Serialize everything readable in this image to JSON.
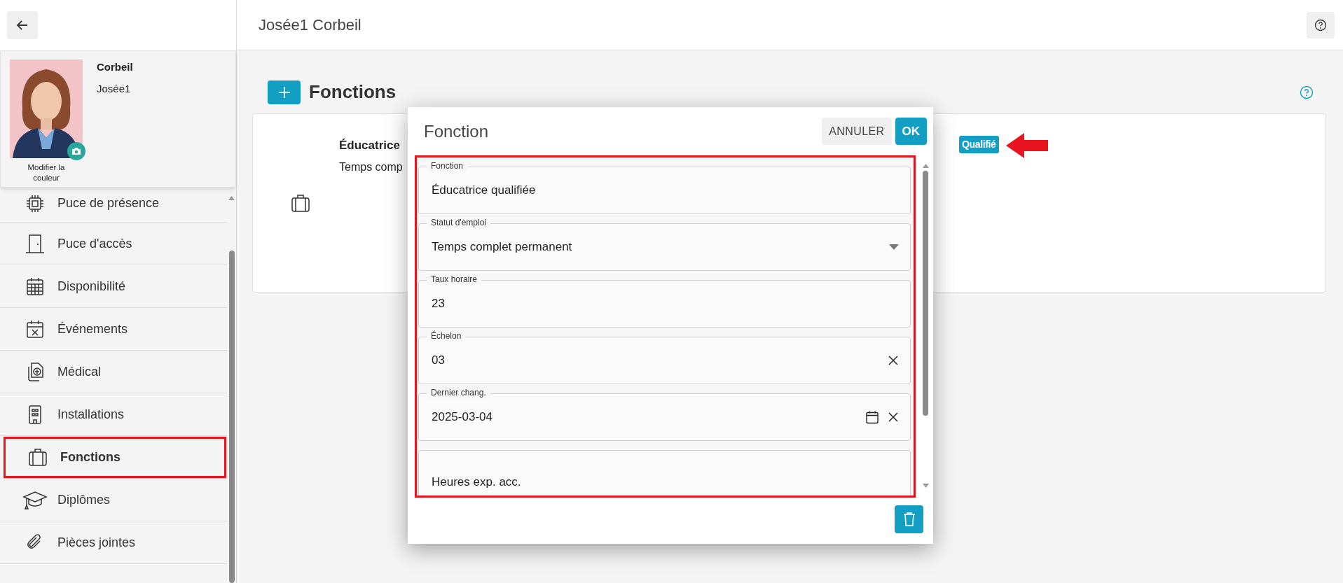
{
  "header": {
    "title": "Josée1 Corbeil"
  },
  "profile": {
    "last_name": "Corbeil",
    "first_name": "Josée1",
    "color_link": "Modifier la couleur"
  },
  "sidebar": {
    "items": [
      {
        "label": "Puce de présence",
        "selected": false
      },
      {
        "label": "Puce d'accès",
        "selected": false
      },
      {
        "label": "Disponibilité",
        "selected": false
      },
      {
        "label": "Événements",
        "selected": false
      },
      {
        "label": "Médical",
        "selected": false
      },
      {
        "label": "Installations",
        "selected": false
      },
      {
        "label": "Fonctions",
        "selected": true
      },
      {
        "label": "Diplômes",
        "selected": false
      },
      {
        "label": "Pièces jointes",
        "selected": false
      }
    ]
  },
  "section": {
    "title": "Fonctions",
    "cards": [
      {
        "title": "Éducatrice",
        "subtitle": "Temps comp",
        "badge": "Qualifié"
      }
    ]
  },
  "dialog": {
    "title": "Fonction",
    "buttons": [
      {
        "label": "ANNULER",
        "kind": "secondary"
      },
      {
        "label": "OK",
        "kind": "primary"
      }
    ],
    "fields": [
      {
        "label": "Fonction",
        "value": "Éducatrice qualifiée",
        "kind": "text"
      },
      {
        "label": "Statut d'emploi",
        "value": "Temps complet permanent",
        "kind": "select"
      },
      {
        "label": "Taux horaire",
        "value": "23",
        "kind": "text"
      },
      {
        "label": "Échelon",
        "value": "03",
        "kind": "clearable"
      },
      {
        "label": "Dernier chang.",
        "value": "2025-03-04",
        "kind": "date"
      },
      {
        "placeholder": "Heures exp. acc.",
        "kind": "text"
      }
    ]
  }
}
